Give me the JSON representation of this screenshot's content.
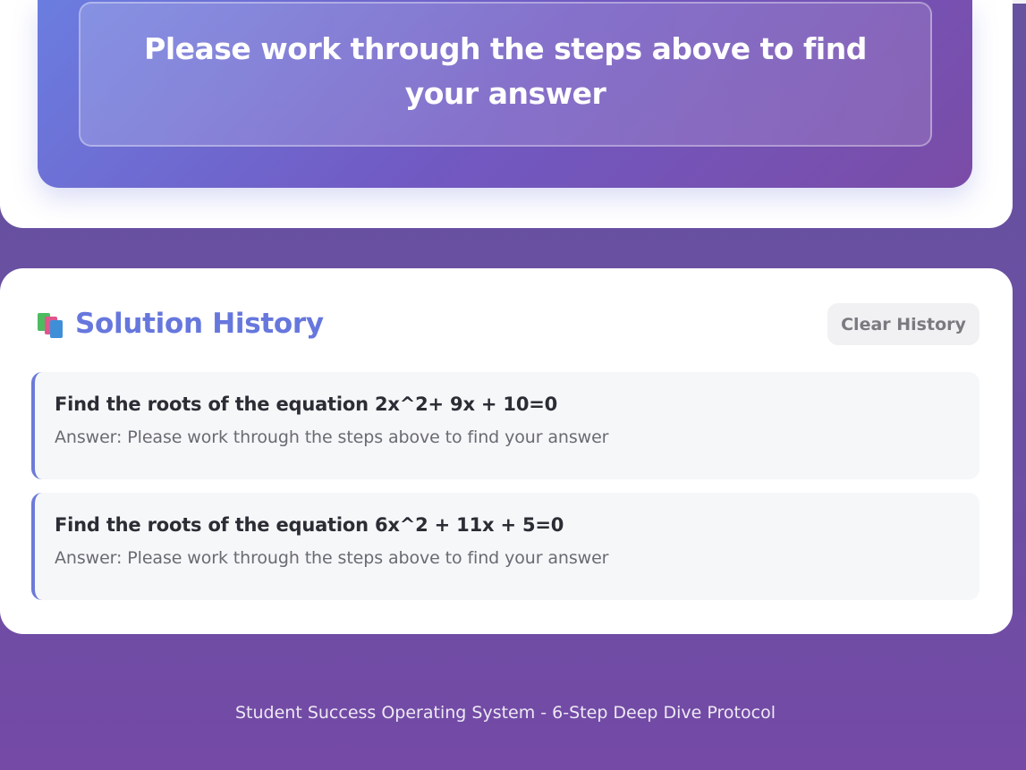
{
  "answer_panel": {
    "text": "Please work through the steps above to find your answer"
  },
  "history": {
    "icon": "books-icon",
    "title": "Solution History",
    "clear_label": "Clear History",
    "items": [
      {
        "question": "Find the roots of the equation 2x^2+ 9x + 10=0",
        "answer": "Answer: Please work through the steps above to find your answer"
      },
      {
        "question": "Find the roots of the equation 6x^2 + 11x + 5=0",
        "answer": "Answer: Please work through the steps above to find your answer"
      }
    ]
  },
  "footer": {
    "text": "Student Success Operating System - 6-Step Deep Dive Protocol"
  },
  "colors": {
    "accent": "#6677dd",
    "background_gradient_start": "#66529f",
    "background_gradient_end": "#744aa6"
  }
}
